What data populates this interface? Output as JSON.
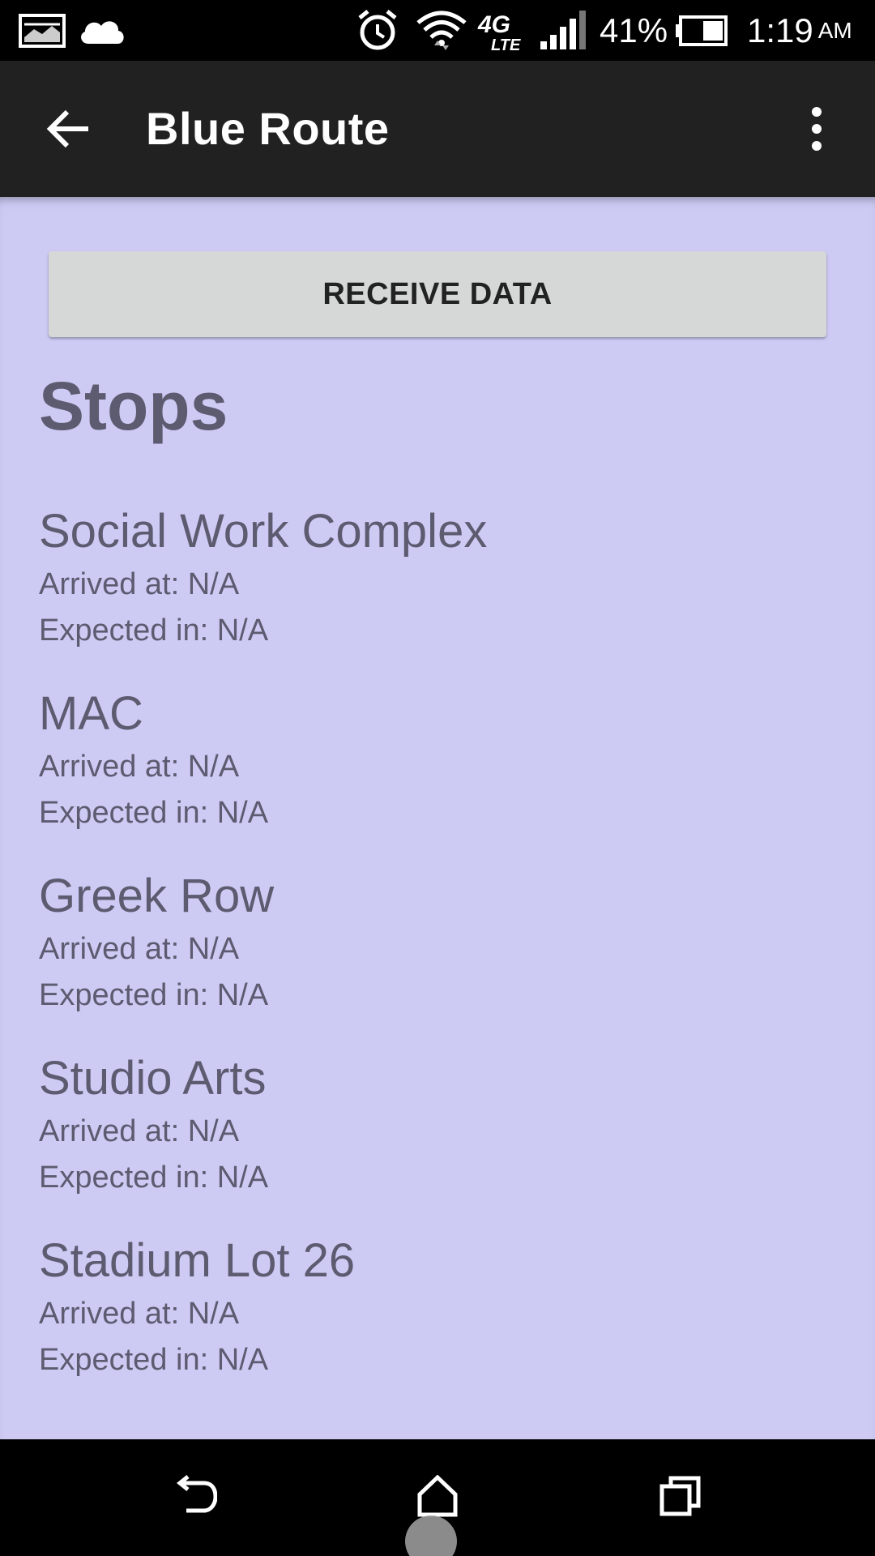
{
  "status_bar": {
    "battery_percent": "41%",
    "time": "1:19",
    "ampm": "AM",
    "network": "4G LTE",
    "icons": [
      "gallery-icon",
      "cloud-icon",
      "alarm-icon",
      "wifi-icon",
      "lte-icon",
      "signal-icon",
      "battery-icon"
    ]
  },
  "app_bar": {
    "title": "Blue Route",
    "back_icon": "arrow-left-icon",
    "menu_icon": "more-vert-icon"
  },
  "main": {
    "receive_button_label": "RECEIVE DATA",
    "stops_heading": "Stops",
    "stops": [
      {
        "name": "Social Work Complex",
        "arrived": "Arrived at: N/A",
        "expected": "Expected in: N/A"
      },
      {
        "name": "MAC",
        "arrived": "Arrived at: N/A",
        "expected": "Expected in: N/A"
      },
      {
        "name": "Greek Row",
        "arrived": "Arrived at: N/A",
        "expected": "Expected in: N/A"
      },
      {
        "name": "Studio Arts",
        "arrived": "Arrived at: N/A",
        "expected": "Expected in: N/A"
      },
      {
        "name": "Stadium Lot 26",
        "arrived": "Arrived at: N/A",
        "expected": "Expected in: N/A"
      }
    ]
  },
  "nav_bar": {
    "icons": [
      "back-nav-icon",
      "home-nav-icon",
      "recents-nav-icon"
    ]
  },
  "colors": {
    "app_bar": "#212121",
    "background": "#cdcbf4",
    "text": "#5c5b70",
    "button": "#d6d7d7"
  }
}
